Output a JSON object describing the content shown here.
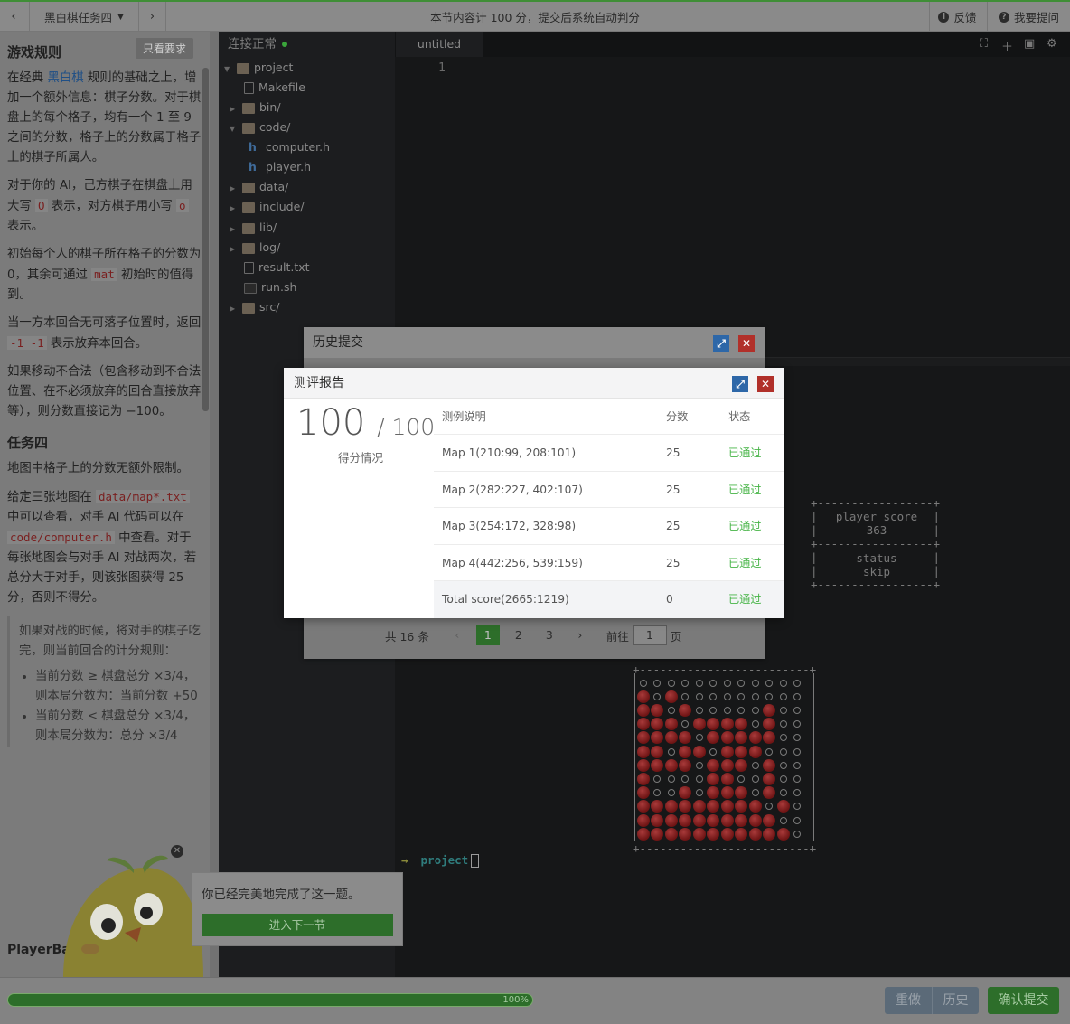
{
  "topbar": {
    "task_title": "黑白棋任务四",
    "notice": "本节内容计 100 分，提交后系统自动判分",
    "feedback": "反馈",
    "ask": "我要提问"
  },
  "doc": {
    "only_req": "只看要求",
    "h_rules": "游戏规则",
    "p1a": "在经典",
    "p1link": "黑白棋",
    "p1b": "规则的基础之上，增加一个额外信息：棋子分数。对于棋盘上的每个格子，均有一个 1 至 9 之间的分数，格子上的分数属于格子上的棋子所属人。",
    "p2a": "对于你的 AI，己方棋子在棋盘上用大写",
    "p2c1": "O",
    "p2b": "表示，对方棋子用小写",
    "p2c2": "o",
    "p2c": "表示。",
    "p3a": "初始每个人的棋子所在格子的分数为 0，其余可通过",
    "p3c": "mat",
    "p3b": "初始时的值得到。",
    "p4a": "当一方本回合无可落子位置时，返回",
    "p4c": "-1 -1",
    "p4b": "表示放弃本回合。",
    "p5": "如果移动不合法（包含移动到不合法位置、在不必须放弃的回合直接放弃等），则分数直接记为 −100。",
    "h_task": "任务四",
    "p6": "地图中格子上的分数无额外限制。",
    "p7a": "给定三张地图在",
    "p7c1": "data/map*.txt",
    "p7b": "中可以查看，对手 AI 代码可以在",
    "p7c2": "code/computer.h",
    "p7c": "中查看。对于每张地图会与对手 AI 对战两次，若总分大于对手，则该张图获得 25 分，否则不得分。",
    "quote": "如果对战的时候，将对手的棋子吃完，则当前回合的计分规则：",
    "li1": "当前分数 ≥ 棋盘总分 ×3/4，则本局分数为：当前分数 +50",
    "li2": "当前分数 < 棋盘总分 ×3/4，则本局分数为：总分 ×3/4",
    "playerba": "PlayerBa"
  },
  "tree": {
    "status": "连接正常",
    "items": [
      "project",
      "Makefile",
      "bin/",
      "code/",
      "computer.h",
      "player.h",
      "data/",
      "include/",
      "lib/",
      "log/",
      "result.txt",
      "run.sh",
      "src/"
    ]
  },
  "editor": {
    "tab": "untitled",
    "line1": "1"
  },
  "terminal": {
    "box_player_label": "player score",
    "box_player_value": "363",
    "box_status_label": "status",
    "box_status_value": "skip",
    "prompt_arrow": "→",
    "prompt_dir": "project"
  },
  "history": {
    "title": "历史提交",
    "total": "共 16 条",
    "pages": [
      "1",
      "2",
      "3"
    ],
    "goto_label": "前往",
    "goto_value": "1",
    "page_suffix": "页"
  },
  "report": {
    "title": "测评报告",
    "score": "100",
    "total": "/ 100",
    "score_label": "得分情况",
    "headers": [
      "测例说明",
      "分数",
      "状态"
    ],
    "rows": [
      [
        "Map 1(210:99, 208:101)",
        "25",
        "已通过"
      ],
      [
        "Map 2(282:227, 402:107)",
        "25",
        "已通过"
      ],
      [
        "Map 3(254:172, 328:98)",
        "25",
        "已通过"
      ],
      [
        "Map 4(442:256, 539:159)",
        "25",
        "已通过"
      ],
      [
        "Total score(2665:1219)",
        "0",
        "已通过"
      ]
    ]
  },
  "toast": {
    "message": "你已经完美地完成了这一题。",
    "next": "进入下一节"
  },
  "bottom": {
    "progress": "100%",
    "progress_value": 1.0,
    "redo": "重做",
    "history": "历史",
    "submit": "确认提交"
  }
}
